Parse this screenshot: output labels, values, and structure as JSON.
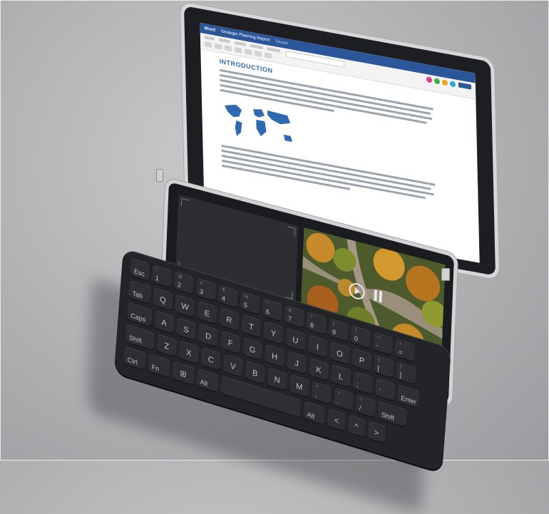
{
  "document": {
    "app": "Word",
    "title": "Strategic Planning Report",
    "status": "Saved",
    "heading": "INTRODUCTION"
  },
  "keyboard": {
    "row1": [
      "Esc",
      "!\n1",
      "@\n2",
      "#\n3",
      "$\n4",
      "%\n5",
      "^\n6",
      "&\n7",
      "*\n8",
      "(\n9",
      ")\n0",
      "—\n-",
      "+\n="
    ],
    "row2": [
      "Tab",
      "Q",
      "W",
      "E",
      "R",
      "T",
      "Y",
      "U",
      "I",
      "O",
      "P",
      "{\n[",
      "}\n]"
    ],
    "row3": [
      "Caps",
      "A",
      "S",
      "D",
      "F",
      "G",
      "H",
      "J",
      "K",
      "L",
      ":\n;",
      "\"\n'",
      "Enter"
    ],
    "row4": [
      "Shift",
      "Z",
      "X",
      "C",
      "V",
      "B",
      "N",
      "M",
      "<\n,",
      ">\n.",
      "?\n/",
      "Shift"
    ],
    "row5": [
      "Ctrl",
      "Fn",
      "⊞",
      "Alt",
      "",
      "Alt",
      "<",
      "^",
      ">"
    ]
  },
  "colors": {
    "word_blue": "#2b579a",
    "bezel": "#1d1e21",
    "key": "#2e2f33",
    "frame": "#d7d7d9"
  }
}
